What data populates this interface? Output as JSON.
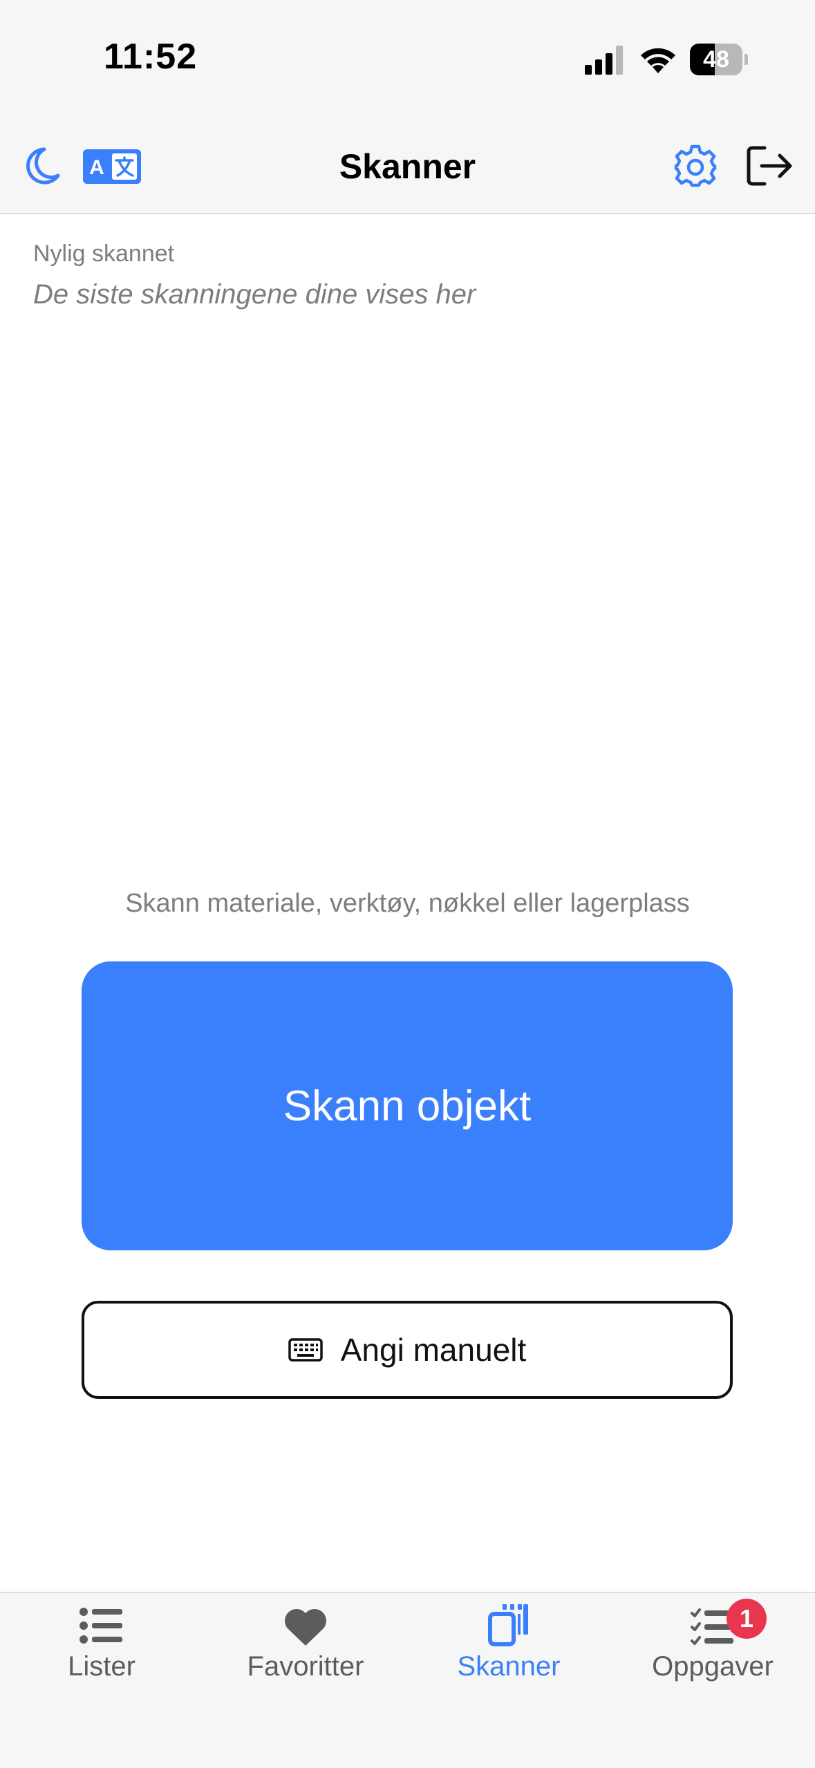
{
  "status_bar": {
    "time": "11:52",
    "battery_level": "48"
  },
  "header": {
    "title": "Skanner",
    "icons": {
      "theme": "moon-icon",
      "language": "translate-icon",
      "settings": "gear-icon",
      "logout": "logout-icon"
    }
  },
  "recent": {
    "label": "Nylig skannet",
    "empty_text": "De siste skanningene dine vises her"
  },
  "scan": {
    "hint": "Skann materiale, verktøy, nøkkel eller lagerplass",
    "primary_button": "Skann objekt",
    "manual_button": "Angi manuelt"
  },
  "tabs": [
    {
      "label": "Lister",
      "icon": "list-icon",
      "active": false
    },
    {
      "label": "Favoritter",
      "icon": "heart-icon",
      "active": false
    },
    {
      "label": "Skanner",
      "icon": "scanner-icon",
      "active": true
    },
    {
      "label": "Oppgaver",
      "icon": "tasks-icon",
      "active": false,
      "badge": "1"
    }
  ],
  "colors": {
    "accent": "#3a7ffb",
    "badge": "#e8364f",
    "muted_text": "#7d7d7d"
  }
}
